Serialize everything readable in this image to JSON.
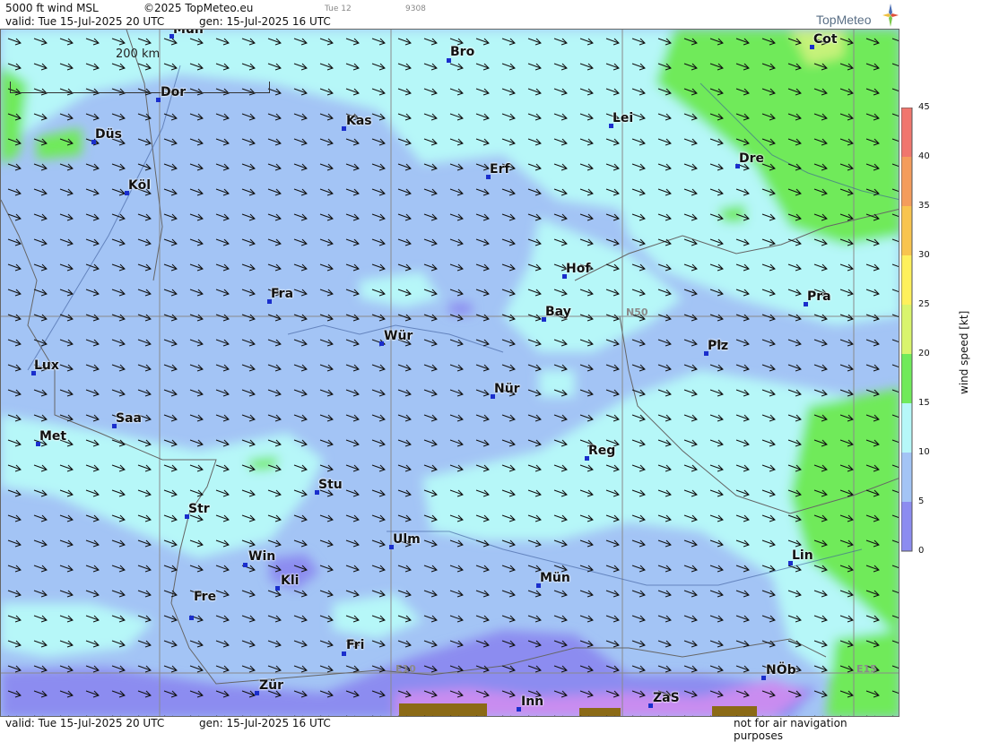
{
  "header": {
    "product": "5000 ft wind MSL",
    "copyright": "©2025 TopMeteo.eu",
    "day_label": "Tue 12",
    "code": "9308",
    "valid": "valid:  Tue  15-Jul-2025  20 UTC",
    "generated": "gen: 15-Jul-2025 16 UTC",
    "brand": "TopMeteo"
  },
  "map": {
    "scale_label": "200 km",
    "grid_labels": {
      "n50": "N50",
      "e10": "E10",
      "e15": "E15"
    },
    "cities": {
      "mun_top": "Mün",
      "bro": "Bro",
      "cot": "Cot",
      "dor": "Dor",
      "kas": "Kas",
      "lei": "Lei",
      "dus": "Düs",
      "erf": "Erf",
      "dre": "Dre",
      "kol": "Köl",
      "hof": "Hof",
      "fra": "Fra",
      "pra": "Pra",
      "bay": "Bay",
      "wur": "Wür",
      "plz": "Plz",
      "lux": "Lux",
      "nur": "Nür",
      "saa": "Saa",
      "met": "Met",
      "reg": "Reg",
      "stu": "Stu",
      "str": "Str",
      "ulm": "Ulm",
      "lin": "Lin",
      "win": "Win",
      "kli": "Kli",
      "mun": "Mün",
      "fre": "Fre",
      "fri": "Fri",
      "nob": "NÖb",
      "zur": "Zür",
      "zas": "ZaS",
      "inn": "Inn"
    },
    "wind_direction": "west-northwest",
    "colors": {
      "calm": "#c98cf0",
      "low": "#9a8cf0",
      "mid": "#a3c4f5",
      "light": "#b6f7f8",
      "green": "#70ea5a",
      "lime": "#c6f27a",
      "terrain": "#8b6a16"
    }
  },
  "legend": {
    "title": "wind speed [kt]",
    "ticks": [
      "45",
      "40",
      "35",
      "30",
      "25",
      "20",
      "15",
      "10",
      "5",
      "0"
    ],
    "colors": [
      "#f0766e",
      "#f49c5c",
      "#f8c44e",
      "#fef05c",
      "#d9f46c",
      "#70ea5a",
      "#b6f7f8",
      "#a3c4f5",
      "#8c8cf0",
      "#c98cf0"
    ]
  },
  "footer": {
    "valid": "valid:  Tue  15-Jul-2025  20 UTC",
    "generated": "gen: 15-Jul-2025 16 UTC",
    "disclaimer": "not for air navigation purposes"
  }
}
